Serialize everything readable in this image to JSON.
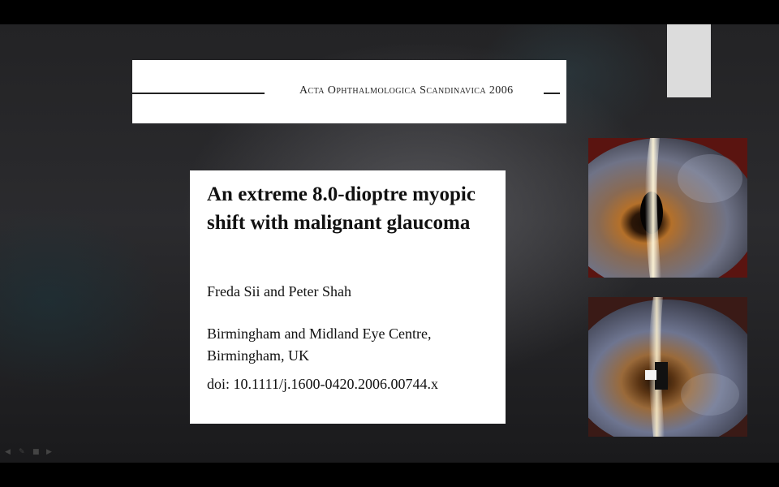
{
  "journal": {
    "name": "Acta Ophthalmologica Scandinavica 2006"
  },
  "paper": {
    "title": "An extreme 8.0-dioptre myopic shift with malignant glaucoma",
    "authors": "Freda Sii and Peter Shah",
    "affiliation": "Birmingham and Midland Eye Centre, Birmingham, UK",
    "doi": "doi: 10.1111/j.1600-0420.2006.00744.x"
  },
  "images": {
    "top": "eye-slit-lamp-photo",
    "bottom": "eye-slit-lamp-photo"
  },
  "controls": {
    "prev_icon": "arrow-left-icon",
    "pen_icon": "pen-icon",
    "menu_icon": "slide-menu-icon",
    "next_icon": "arrow-right-icon"
  },
  "colors": {
    "background": "#000000",
    "slide": "#2a2a2d",
    "card": "#ffffff",
    "text": "#111111"
  }
}
